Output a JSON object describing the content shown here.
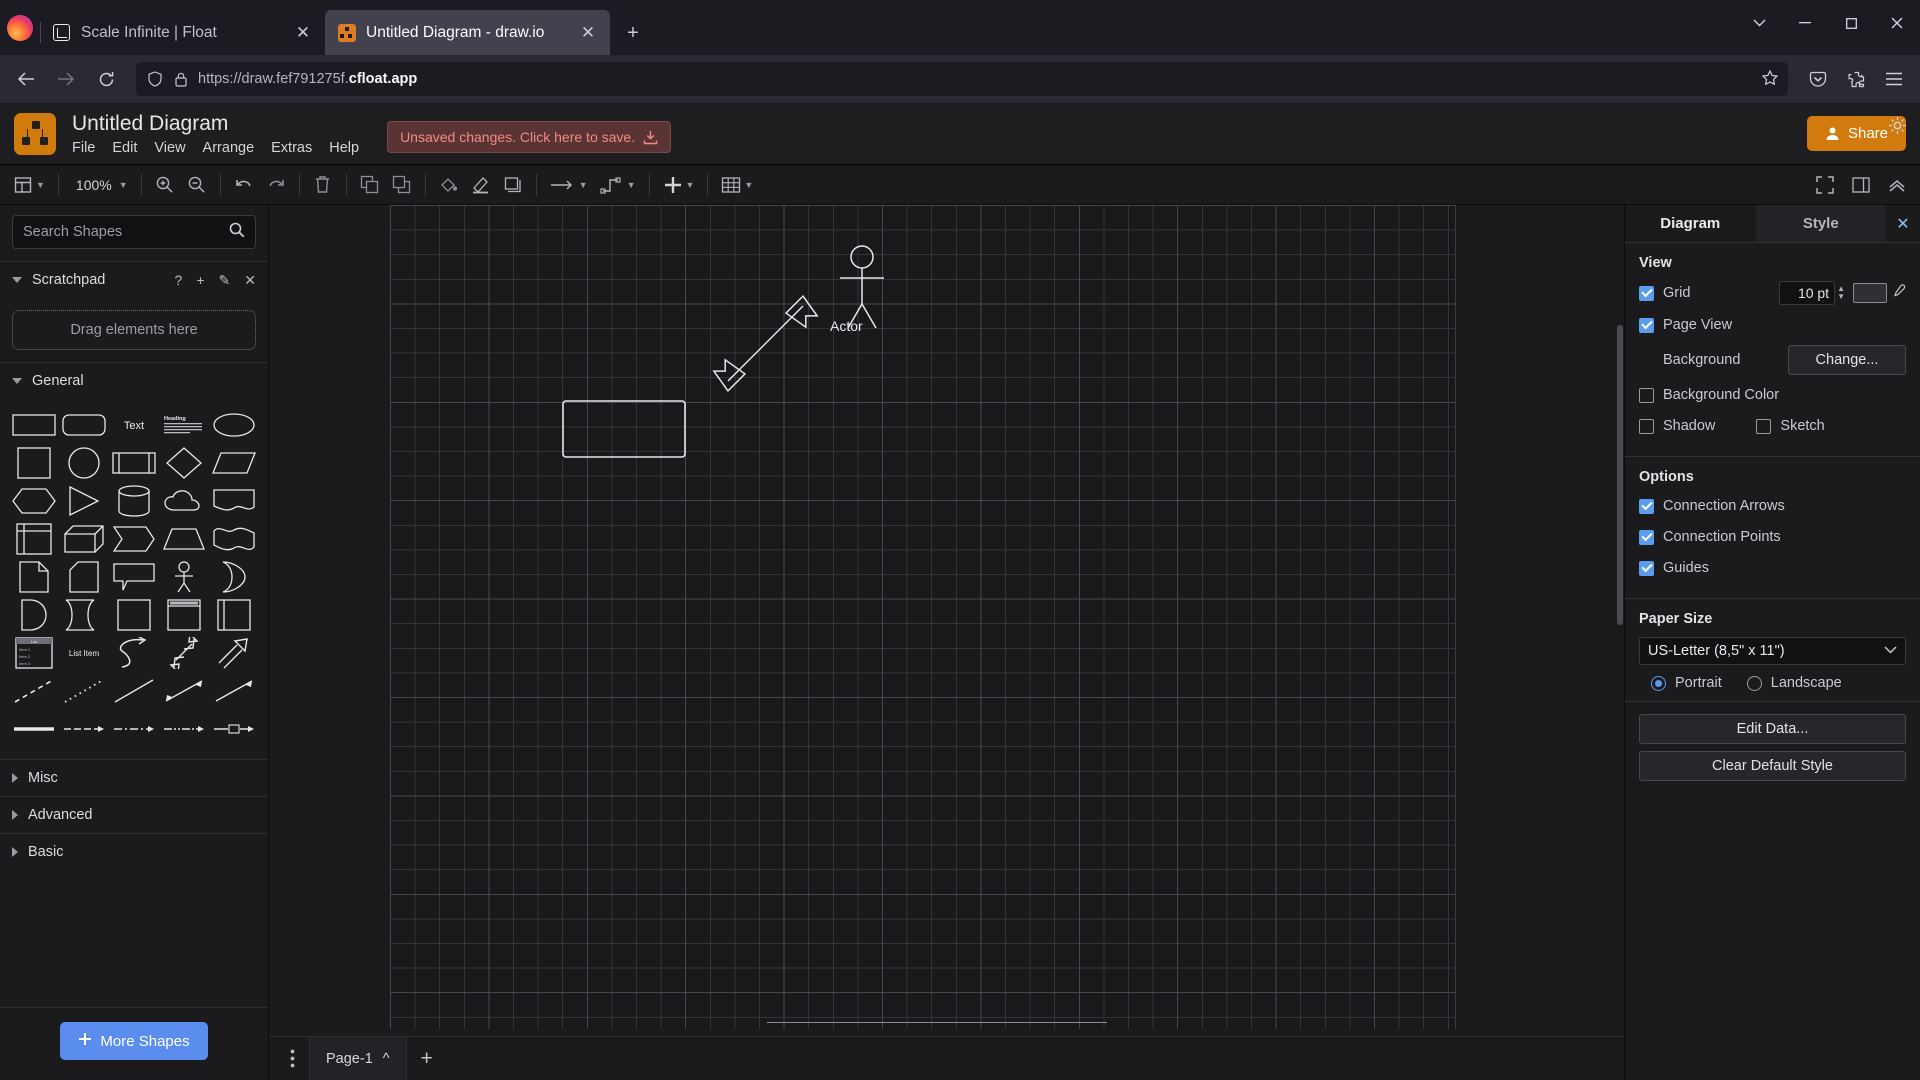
{
  "browser": {
    "tabs": [
      {
        "title": "Scale Infinite | Float",
        "icon": "float-icon",
        "active": false
      },
      {
        "title": "Untitled Diagram - draw.io",
        "icon": "drawio-icon",
        "active": true
      }
    ],
    "new_tab_label": "+",
    "close_label": "✕",
    "window_controls": {
      "list_all_tabs": "⌵",
      "minimize": "—",
      "maximize": "❐",
      "close": "✕"
    },
    "nav": {
      "back": "←",
      "forward": "→",
      "reload": "↻"
    },
    "url": {
      "prefix": "https://draw.fef791275f.",
      "domain": "cfloat.app"
    },
    "toolbar_right": {
      "save_to_pocket": "pocket-icon",
      "extensions": "extensions-icon",
      "app_menu": "☰"
    }
  },
  "app": {
    "title": "Untitled Diagram",
    "menu": [
      "File",
      "Edit",
      "View",
      "Arrange",
      "Extras",
      "Help"
    ],
    "save_banner": "Unsaved changes. Click here to save.",
    "share_label": "Share",
    "toolbar": {
      "zoom_level": "100%",
      "view_label": "view-icon",
      "zoom_in": "zoom-in-icon",
      "zoom_out": "zoom-out-icon",
      "undo": "undo-icon",
      "redo": "redo-icon",
      "delete": "trash-icon",
      "to_front": "to-front-icon",
      "to_back": "to-back-icon",
      "fill_color": "fill-color-icon",
      "line_color": "line-color-icon",
      "shadow": "shadow-icon",
      "connection": "connection-arrow-icon",
      "waypoints": "waypoints-icon",
      "insert": "plus-icon",
      "table": "table-icon",
      "fullscreen": "fullscreen-icon",
      "format_panel": "format-panel-icon",
      "collapse": "collapse-icon"
    }
  },
  "sidebar": {
    "search_placeholder": "Search Shapes",
    "search_value": "",
    "search_icon": "search-icon",
    "sections": [
      {
        "label": "Scratchpad",
        "expanded": true,
        "actions": [
          "?",
          "+",
          "✎",
          "✕"
        ]
      },
      {
        "label": "General",
        "expanded": true
      },
      {
        "label": "Misc",
        "expanded": false
      },
      {
        "label": "Advanced",
        "expanded": false
      },
      {
        "label": "Basic",
        "expanded": false
      }
    ],
    "scratchpad_placeholder": "Drag elements here",
    "more_shapes_label": "More Shapes",
    "shapes": [
      "rectangle",
      "rounded-rectangle",
      "text",
      "heading-text",
      "ellipse",
      "square",
      "circle",
      "process",
      "rhombus",
      "parallelogram",
      "hexagon",
      "triangle",
      "cylinder",
      "cloud",
      "document",
      "internal-storage",
      "cube",
      "step",
      "trapezoid",
      "tape",
      "note",
      "card",
      "callout",
      "actor",
      "or",
      "and",
      "data-storage",
      "container",
      "vertical-container",
      "horizontal-container",
      "list",
      "list-item",
      "curved-arrow",
      "bidirectional-arrow",
      "block-arrow",
      "dashed-line",
      "dotted-line",
      "plain-line",
      "bidirectional-line",
      "directional-line",
      "thick-line",
      "dashed-arrow",
      "dash-dot-arrow",
      "dash-dot-dot-arrow",
      "labeled-arrow"
    ]
  },
  "canvas": {
    "shapes": [
      {
        "type": "actor",
        "label": "Actor"
      },
      {
        "type": "double-arrow",
        "label": ""
      },
      {
        "type": "rectangle",
        "label": ""
      }
    ]
  },
  "footer": {
    "menu_icon": "vertical-dots-icon",
    "page_name": "Page-1",
    "page_caret": "^",
    "add_page": "+"
  },
  "format_panel": {
    "tabs": [
      {
        "label": "Diagram",
        "active": true
      },
      {
        "label": "Style",
        "active": false
      }
    ],
    "close_label": "✕",
    "view": {
      "heading": "View",
      "grid": {
        "label": "Grid",
        "checked": true,
        "size": "10 pt",
        "color": "#2f2f34"
      },
      "page_view": {
        "label": "Page View",
        "checked": true
      },
      "background": {
        "label": "Background",
        "button": "Change..."
      },
      "background_color": {
        "label": "Background Color",
        "checked": false
      },
      "shadow": {
        "label": "Shadow",
        "checked": false
      },
      "sketch": {
        "label": "Sketch",
        "checked": false
      }
    },
    "options": {
      "heading": "Options",
      "items": [
        {
          "label": "Connection Arrows",
          "checked": true
        },
        {
          "label": "Connection Points",
          "checked": true
        },
        {
          "label": "Guides",
          "checked": true
        }
      ]
    },
    "paper": {
      "heading": "Paper Size",
      "selected": "US-Letter (8,5\" x 11\")",
      "orientation": [
        {
          "label": "Portrait",
          "selected": true
        },
        {
          "label": "Landscape",
          "selected": false
        }
      ]
    },
    "buttons": [
      "Edit Data...",
      "Clear Default Style"
    ]
  },
  "colors": {
    "accent_orange": "#d17b0f",
    "accent_blue": "#5a8dee",
    "checkbox_blue": "#5a9ded",
    "banner_red": "#f08b7e"
  }
}
